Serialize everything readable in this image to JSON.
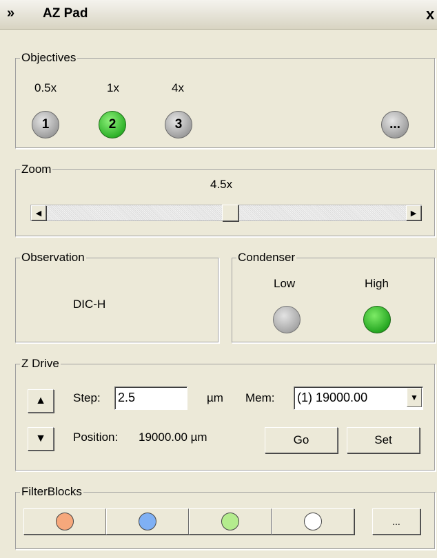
{
  "window": {
    "title": "AZ Pad",
    "collapse_glyph": "»",
    "close_glyph": "x"
  },
  "objectives": {
    "legend": "Objectives",
    "items": [
      {
        "mag": "0.5x",
        "num": "1",
        "active": false
      },
      {
        "mag": "1x",
        "num": "2",
        "active": true
      },
      {
        "mag": "4x",
        "num": "3",
        "active": false
      }
    ],
    "more_label": "..."
  },
  "zoom": {
    "legend": "Zoom",
    "value": "4.5x",
    "slider_fraction": 0.51,
    "left_arrow": "◀",
    "right_arrow": "▶"
  },
  "observation": {
    "legend": "Observation",
    "value": "DIC-H"
  },
  "condenser": {
    "legend": "Condenser",
    "low_label": "Low",
    "high_label": "High",
    "selected": "High"
  },
  "zdrive": {
    "legend": "Z Drive",
    "step_label": "Step:",
    "step_value": "2.5",
    "step_unit": "µm",
    "mem_label": "Mem:",
    "mem_value": "(1) 19000.00",
    "position_label": "Position:",
    "position_value": "19000.00 µm",
    "go_label": "Go",
    "set_label": "Set"
  },
  "filterblocks": {
    "legend": "FilterBlocks",
    "colors": [
      "#f6a87c",
      "#7fb0f4",
      "#b4ec8e",
      "#ffffff"
    ],
    "more_label": "..."
  }
}
